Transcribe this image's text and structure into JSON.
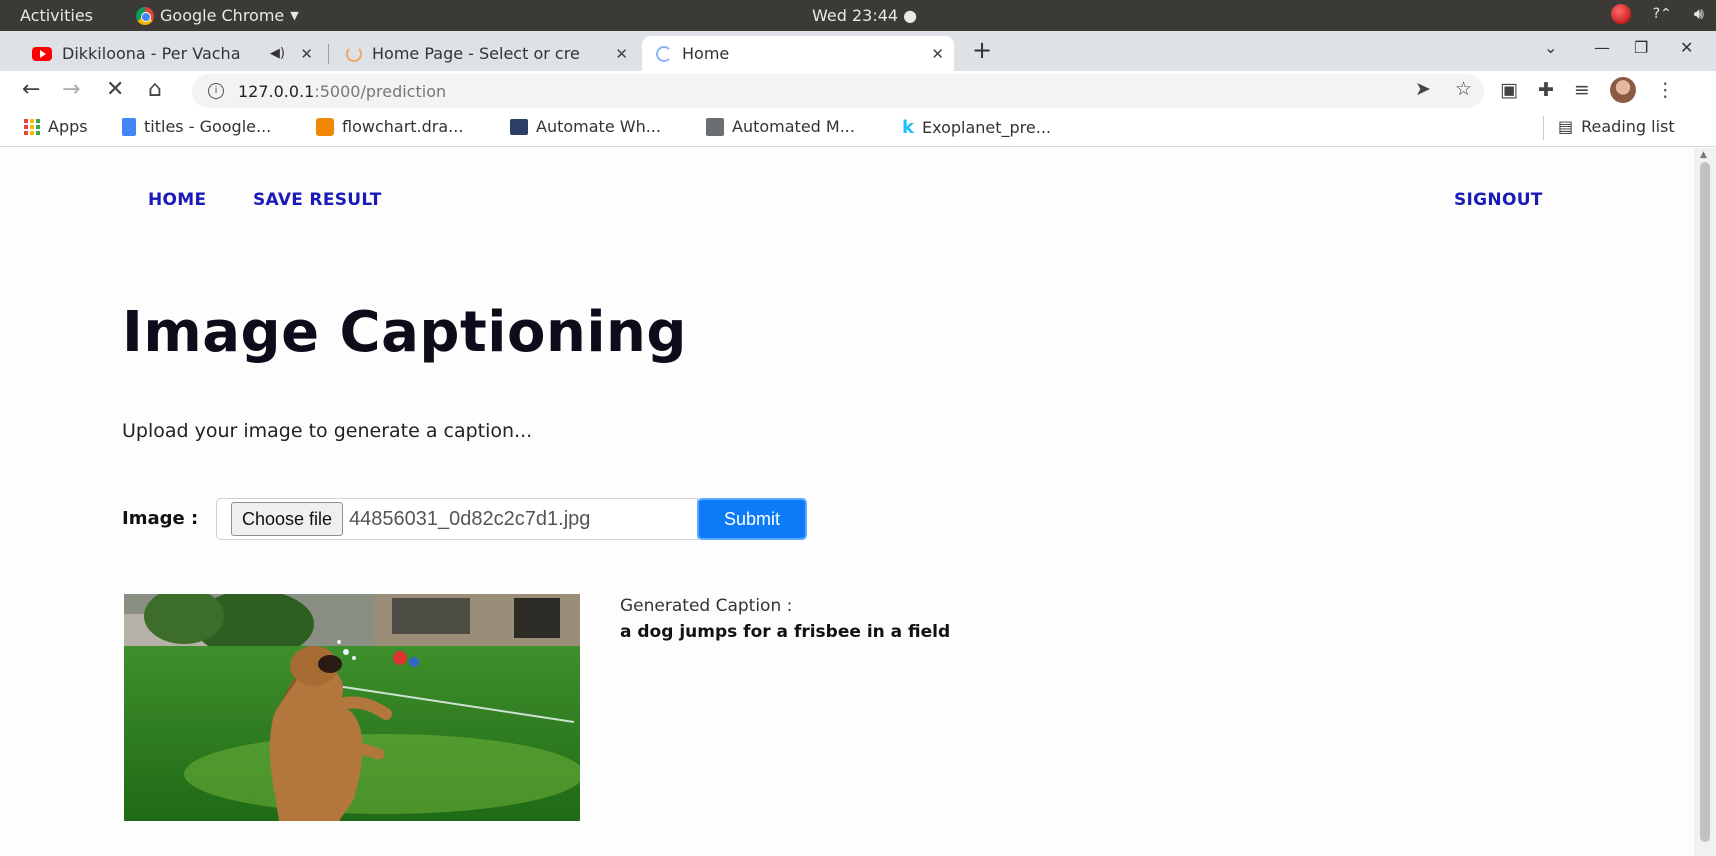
{
  "system": {
    "activities": "Activities",
    "app_name": "Google Chrome",
    "clock": "Wed 23:44 ●"
  },
  "tabs": [
    {
      "title": "Dikkiloona - Per Vacha",
      "icon": "youtube-icon"
    },
    {
      "title": "Home Page - Select or cre",
      "icon": "loading-icon"
    },
    {
      "title": "Home",
      "icon": "loading-spinner-icon",
      "active": true
    }
  ],
  "address": {
    "host": "127.0.0.1",
    "path": ":5000/prediction"
  },
  "bookmarks": [
    {
      "label": "Apps",
      "icon": "apps-grid-icon"
    },
    {
      "label": "titles - Google...",
      "icon": "docs-icon"
    },
    {
      "label": "flowchart.dra...",
      "icon": "drawio-icon"
    },
    {
      "label": "Automate Wh...",
      "icon": "bookmark-icon"
    },
    {
      "label": "Automated M...",
      "icon": "bookmark-icon"
    },
    {
      "label": "Exoplanet_pre...",
      "icon": "kaggle-icon"
    }
  ],
  "reading_list": "Reading list",
  "site_nav": {
    "home": "HOME",
    "save_result": "SAVE RESULT",
    "signout": "SIGNOUT"
  },
  "main": {
    "heading": "Image Captioning",
    "lead": "Upload your image to generate a caption...",
    "image_label": "Image :",
    "choose_file": "Choose file",
    "filename": "44856031_0d82c2c7d1.jpg",
    "submit": "Submit",
    "caption_label": "Generated Caption :",
    "caption": "a dog jumps for a frisbee in a field"
  },
  "colors": {
    "nav_link": "#1a1ab8",
    "submit_bg": "#0d7bf7",
    "topbar_bg": "#3b3a36",
    "tabstrip_bg": "#dee1e6"
  }
}
